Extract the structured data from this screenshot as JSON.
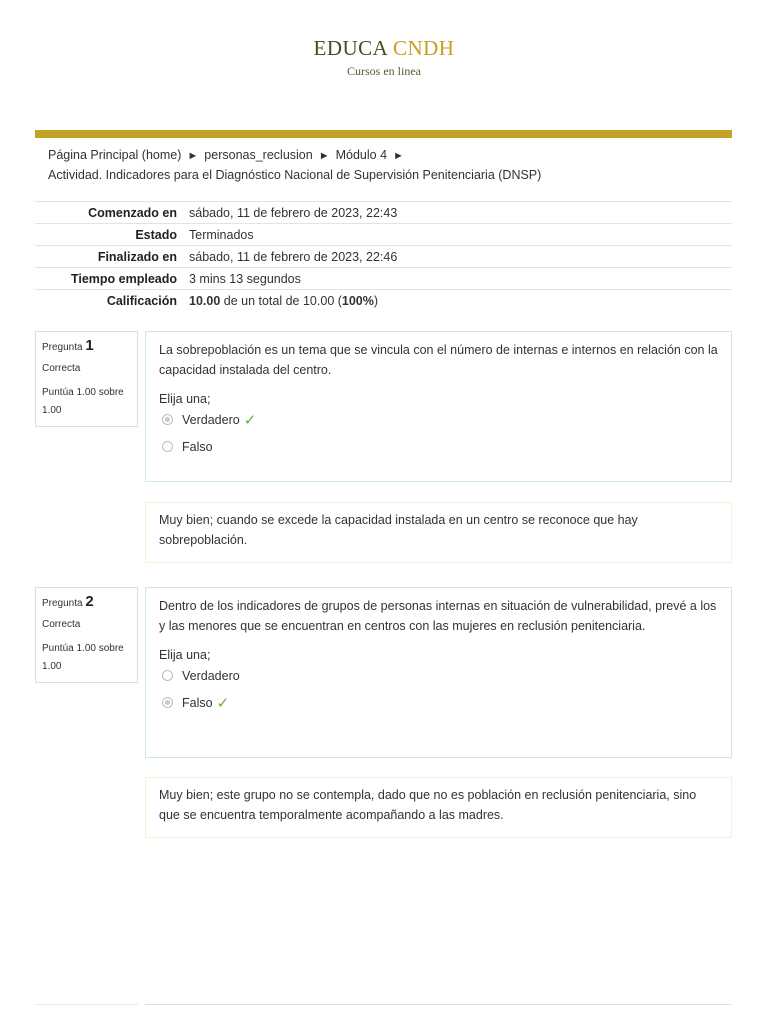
{
  "brand": {
    "name_part1": "EDUCA",
    "name_part2": "CNDH",
    "subtitle": "Cursos en linea"
  },
  "breadcrumb": {
    "items": [
      "Página Principal (home)",
      "personas_reclusion",
      "Módulo 4"
    ],
    "separator": "►",
    "current": "Actividad. Indicadores para el Diagnóstico Nacional de Supervisión Penitenciaria (DNSP)"
  },
  "summary": {
    "rows": [
      {
        "label": "Comenzado en",
        "value": "sábado, 11 de febrero de 2023, 22:43"
      },
      {
        "label": "Estado",
        "value": "Terminados"
      },
      {
        "label": "Finalizado en",
        "value": "sábado, 11 de febrero de 2023, 22:46"
      },
      {
        "label": "Tiempo empleado",
        "value": "3 mins 13 segundos"
      }
    ],
    "grade": {
      "label": "Calificación",
      "score": "10.00",
      "middle": " de un total de 10.00 (",
      "percent": "100%",
      "end": ")"
    }
  },
  "questions": [
    {
      "label": "Pregunta",
      "number": "1",
      "state": "Correcta",
      "grade": "Puntúa 1.00 sobre 1.00",
      "text": "La sobrepoblación es un tema que se vincula con el número de internas e internos en relación con la capacidad instalada del centro.",
      "prompt": "Elija una;",
      "options": [
        "Verdadero",
        "Falso"
      ],
      "selected": "Verdadero",
      "feedback": "Muy bien; cuando se excede la capacidad instalada en un centro se reconoce que hay sobrepoblación."
    },
    {
      "label": "Pregunta",
      "number": "2",
      "state": "Correcta",
      "grade": "Puntúa 1.00 sobre 1.00",
      "text": "Dentro de los indicadores de grupos de personas internas en situación de vulnerabilidad, prevé a los y las menores que se encuentran en centros con las mujeres en reclusión penitenciaria.",
      "prompt": "Elija una;",
      "options": [
        "Verdadero",
        "Falso"
      ],
      "selected": "Falso",
      "feedback": "Muy bien; este grupo no se contempla, dado que no es población en reclusión penitenciaria, sino que se encuentra temporalmente acompañando a las madres."
    }
  ],
  "icons": {
    "correct": "checkmark-icon",
    "radio": "radio-icon"
  },
  "colors": {
    "gold": "#c3a128",
    "check_green": "#5bb832",
    "question_border": "#cde7ef",
    "feedback_border": "#fbeed5"
  }
}
